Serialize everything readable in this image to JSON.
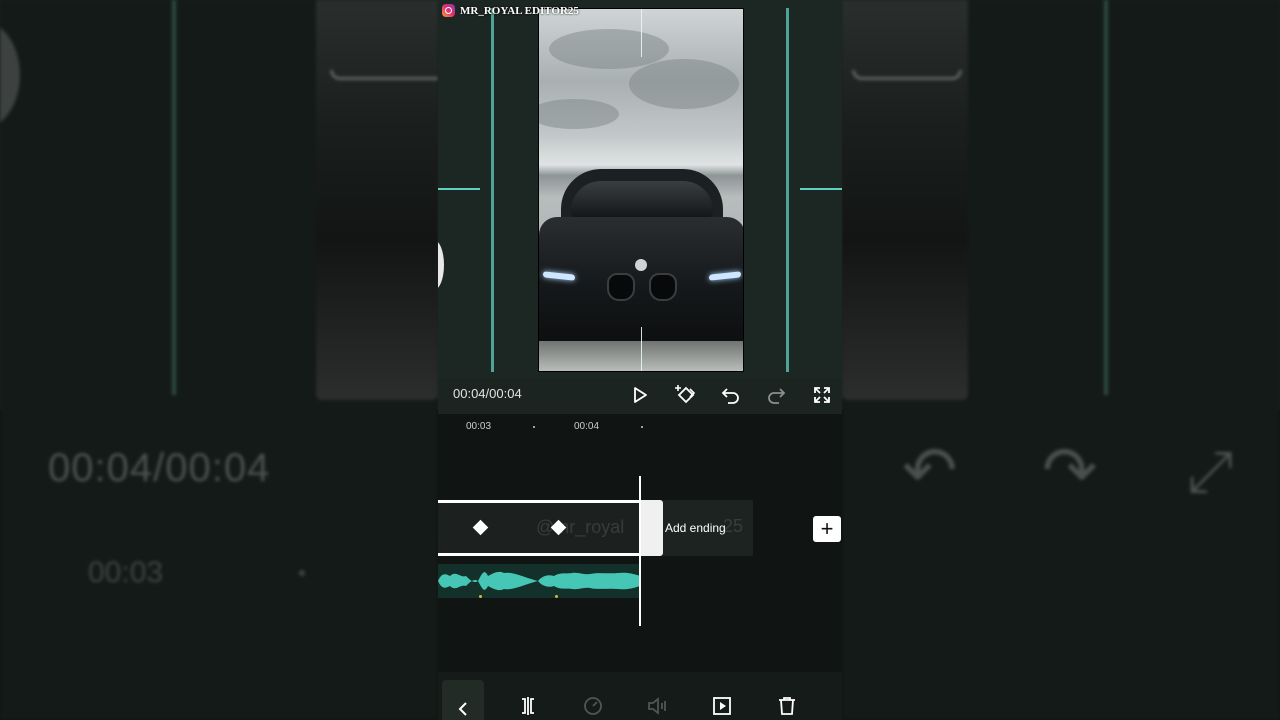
{
  "watermark": {
    "text": "MR_ROYAL EDITOR25",
    "icon": "instagram-icon"
  },
  "player": {
    "timecode": "00:04/00:04",
    "controls": [
      "play-icon",
      "keyframe-add-icon",
      "undo-icon",
      "redo-icon",
      "fullscreen-icon"
    ]
  },
  "timeline": {
    "ruler": [
      "00:03",
      "00:04"
    ],
    "clip_ghost_text": "@mr_royal",
    "add_ending_label": "Add ending",
    "add_ending_ghost": "25",
    "add_button": "+"
  },
  "background": {
    "timecode": "00:04/00:04",
    "ruler_label": "00:03"
  },
  "toolbar": {
    "items": [
      "back-icon",
      "split-icon",
      "speed-icon",
      "volume-icon",
      "animation-icon",
      "delete-icon"
    ]
  },
  "colors": {
    "accent": "#5fd0bf",
    "audio_wave": "#46c7b6",
    "panel": "#1b2420"
  }
}
